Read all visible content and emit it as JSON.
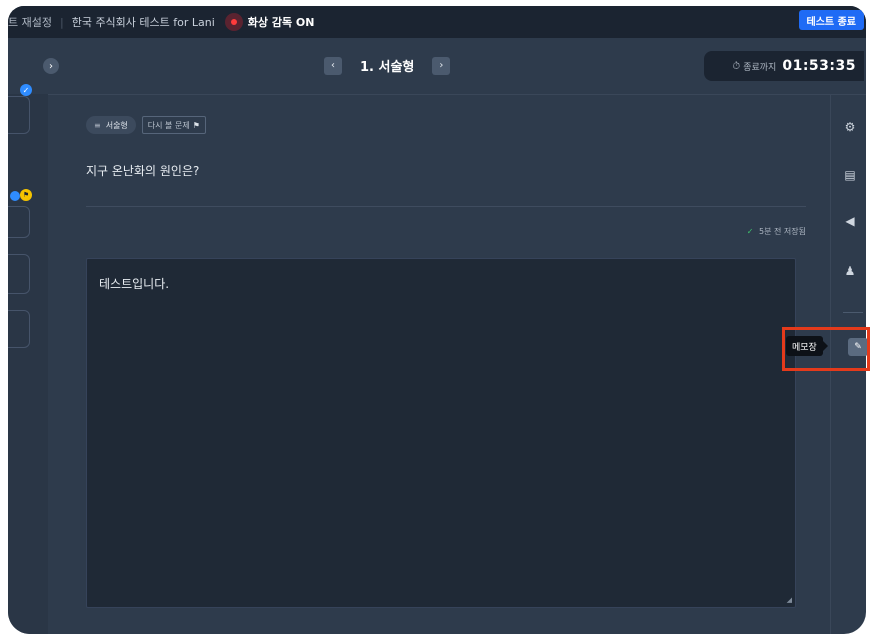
{
  "topbar": {
    "reset_label": "트 재설정",
    "test_name": "한국 주식회사 테스트 for Lani",
    "monitor_label": "화상 감독 ON",
    "end_button": "테스트 종료"
  },
  "nav": {
    "expand_icon": "›",
    "prev_icon": "‹",
    "next_icon": "›",
    "question_title": "1. 서술형",
    "timer_label": "종료까지",
    "timer_value": "01:53:35"
  },
  "question": {
    "type_tag": "서술형",
    "review_tag": "다시 볼 문제",
    "text": "지구 온난화의 원인은?",
    "saved_status": "5분 전 저장됨",
    "answer_text": "테스트입니다."
  },
  "memo": {
    "tooltip": "메모장"
  },
  "colors": {
    "accent": "#1f6bf5",
    "highlight": "#e43a1b",
    "saved_check": "#3ec46d",
    "panel_bg": "#2e3b4c"
  }
}
